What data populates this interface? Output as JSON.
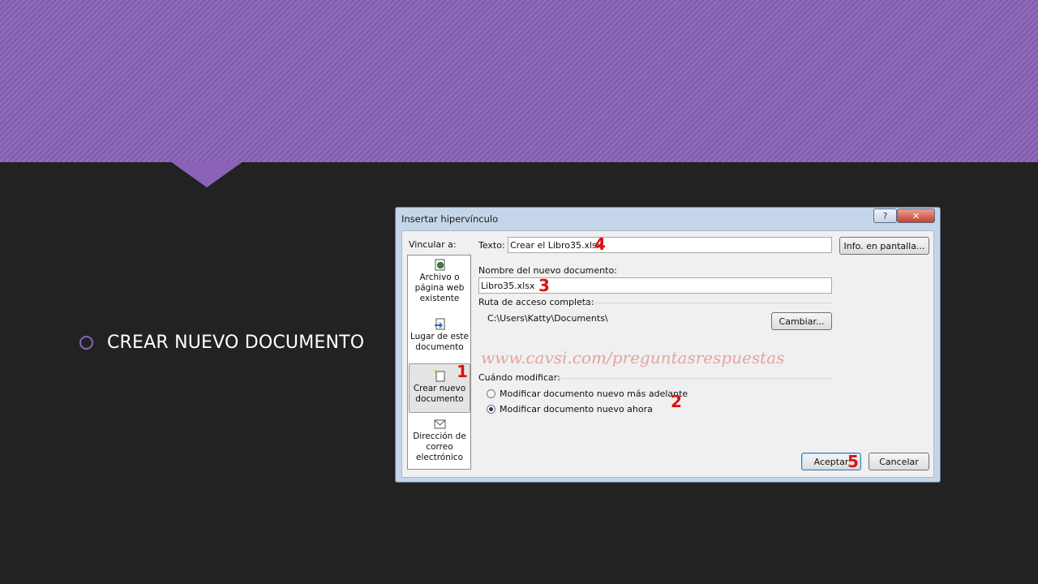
{
  "slide": {
    "bullet_text": "CREAR NUEVO DOCUMENTO"
  },
  "dialog": {
    "title": "Insertar hipervínculo",
    "help_label": "?",
    "close_label": "✕",
    "link_to_label": "Vincular a:",
    "link_items": [
      {
        "label": "Archivo o página web existente",
        "icon": "web-page-icon"
      },
      {
        "label": "Lugar de este documento",
        "icon": "place-in-document-icon"
      },
      {
        "label": "Crear nuevo documento",
        "icon": "new-document-icon",
        "selected": true
      },
      {
        "label": "Dirección de correo electrónico",
        "icon": "email-address-icon"
      }
    ],
    "text_label": "Texto:",
    "text_value": "Crear el Libro35.xlsx",
    "screentip_button": "Info. en pantalla...",
    "new_doc_name_label": "Nombre del nuevo documento:",
    "new_doc_name_value": "Libro35.xlsx",
    "full_path_label": "Ruta de acceso completa:",
    "full_path_value": "C:\\Users\\Katty\\Documents\\",
    "change_button": "Cambiar...",
    "watermark": "www.cavsi.com/preguntasrespuestas",
    "when_edit_label": "Cuándo modificar:",
    "edit_options": [
      {
        "label": "Modificar documento nuevo más adelante",
        "checked": false
      },
      {
        "label": "Modificar documento nuevo ahora",
        "checked": true
      }
    ],
    "ok_button": "Aceptar",
    "cancel_button": "Cancelar",
    "steps": {
      "s1": "1",
      "s2": "2",
      "s3": "3",
      "s4": "4",
      "s5": "5"
    }
  },
  "colors": {
    "header_purple": "#8a63b8",
    "background": "#222222",
    "step_red": "#e01010"
  }
}
